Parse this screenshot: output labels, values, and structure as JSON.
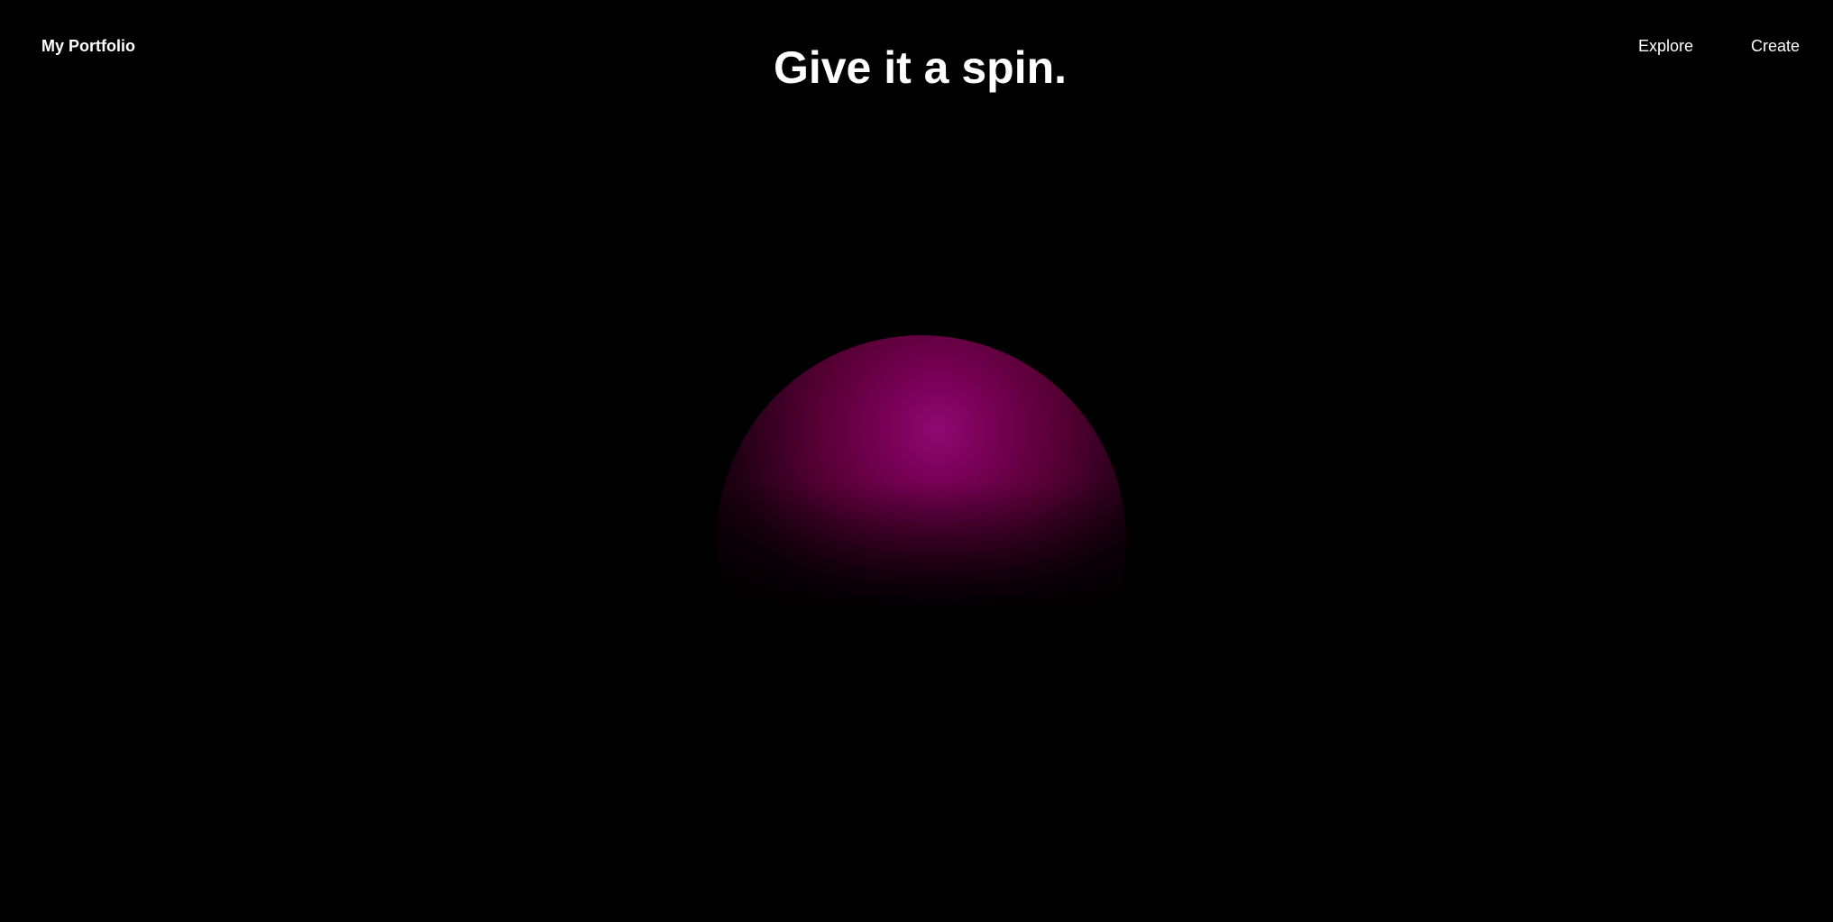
{
  "header": {
    "brand": "My Portfolio",
    "nav": [
      {
        "label": "Explore"
      },
      {
        "label": "Create"
      }
    ]
  },
  "hero": {
    "headline": "Give it a spin."
  },
  "scene": {
    "object": "sphere",
    "colors": {
      "background": "#000000",
      "highlight": "#8e0a72",
      "body": "#6b0040",
      "shadow": "#000000"
    }
  }
}
